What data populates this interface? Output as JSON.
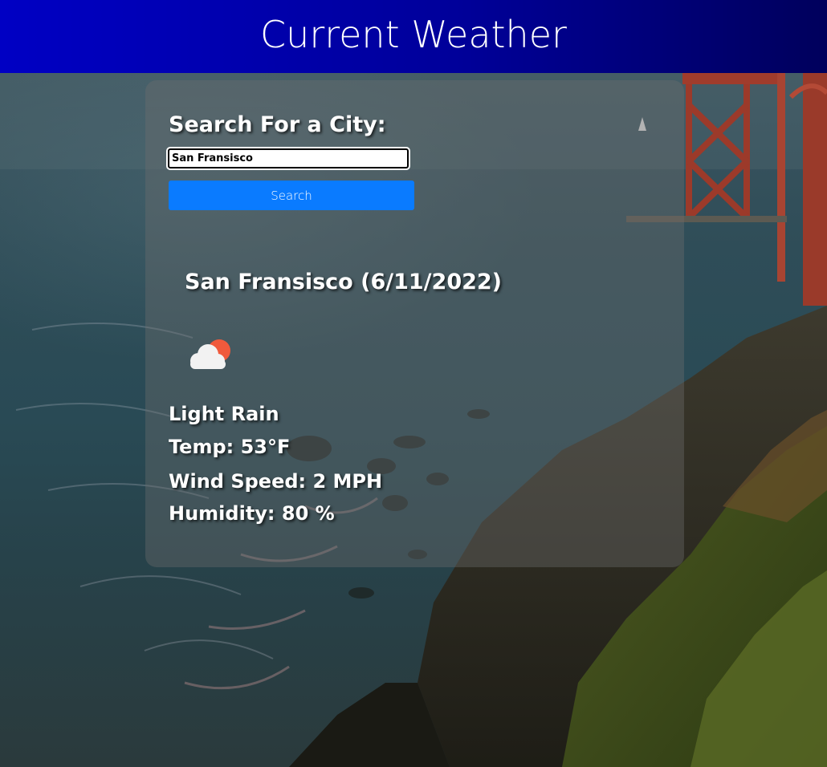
{
  "header": {
    "title": "Current Weather"
  },
  "search": {
    "label": "Search For a City:",
    "input_value": "San Fransisco",
    "placeholder": "",
    "button_label": "Search"
  },
  "current": {
    "city_heading": "San Fransisco (6/11/2022)",
    "icon": "cloud-sun-icon",
    "description": "Light Rain",
    "temp": "Temp: 53°F",
    "wind": "Wind Speed: 2 MPH",
    "humidity": "Humidity: 80 %"
  },
  "colors": {
    "header_left": "#0000c4",
    "header_right": "#00005c",
    "button": "#0a7bff",
    "sun": "#f05a3c"
  }
}
